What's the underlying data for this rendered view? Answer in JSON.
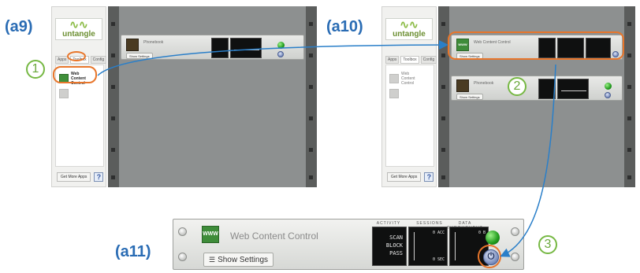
{
  "steps": {
    "a9": "(a9)",
    "a10": "(a10)",
    "a11": "(a11)"
  },
  "badges": [
    "1",
    "2",
    "3"
  ],
  "logo": {
    "wave": "∿∿",
    "word": "untangle"
  },
  "side_tabs": [
    "Apps",
    "Toolbox",
    "Config"
  ],
  "side_apps": {
    "web_content_control": "Web Content Control",
    "blank": ""
  },
  "side_footer": {
    "button": "Get More Apps",
    "help": "?"
  },
  "modules": {
    "phonebook": "Phonebook",
    "web_content_control": "Web Content Control",
    "www_icon": "WWW"
  },
  "show_settings": "Show Settings",
  "a11_screens": {
    "col1_header": "ACTIVITY",
    "col2_header": "SESSIONS",
    "col3_header": "DATA THROUGHPUT",
    "lines": [
      "SCAN",
      "BLOCK",
      "PASS"
    ],
    "acc": "0 ACC",
    "sec": "0 SEC",
    "kb": "0 B"
  },
  "colors": {
    "step_label": "#2a6cb4",
    "highlight": "#e8762b",
    "badge": "#76b843",
    "arrow": "#2a7fc9"
  }
}
